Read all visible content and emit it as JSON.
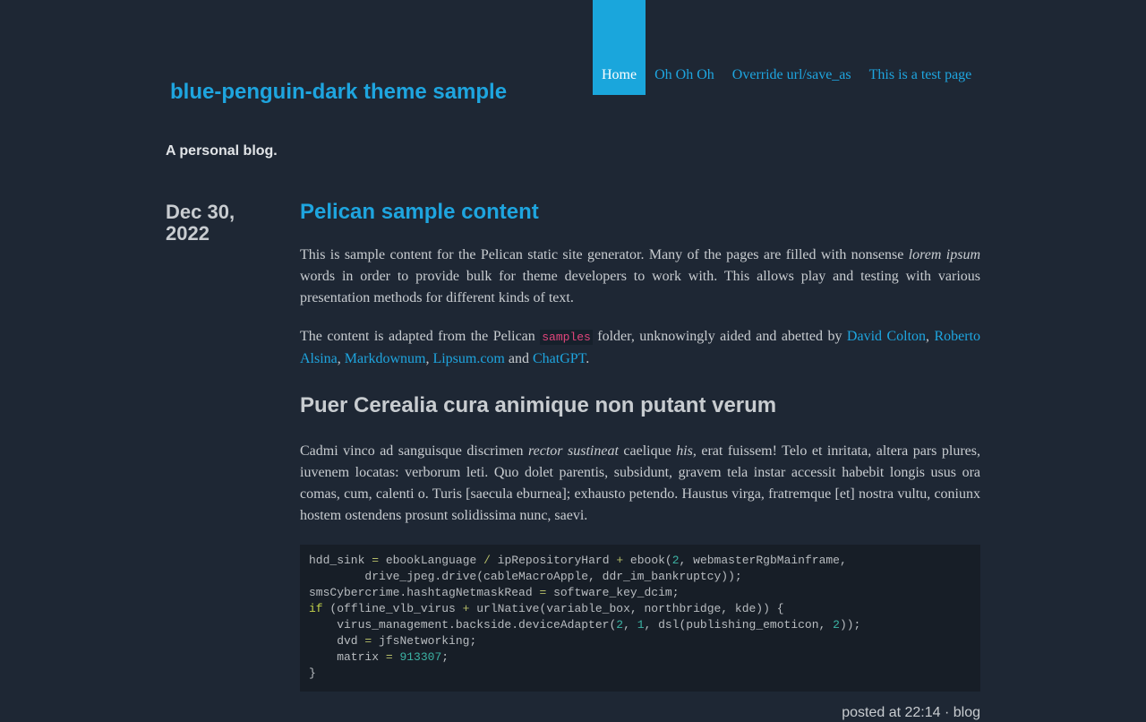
{
  "site": {
    "title": "blue-penguin-dark theme sample",
    "tagline": "A personal blog."
  },
  "nav": {
    "items": [
      {
        "label": "Home",
        "active": true
      },
      {
        "label": "Oh Oh Oh",
        "active": false
      },
      {
        "label": "Override url/save_as",
        "active": false
      },
      {
        "label": "This is a test page",
        "active": false
      }
    ]
  },
  "article": {
    "date": "Dec 30, 2022",
    "title": "Pelican sample content",
    "p1": {
      "text1": "This is sample content for the Pelican static site generator. Many of the pages are filled with nonsense ",
      "em": "lorem ipsum",
      "text2": " words in order to provide bulk for theme developers to work with. This allows play and testing with various presentation methods for different kinds of text."
    },
    "p2": {
      "text1": "The content is adapted from the Pelican ",
      "code": "samples",
      "text2": " folder, unknowingly aided and abetted by ",
      "link1": "David Colton",
      "sep1": ", ",
      "link2": "Roberto Alsina",
      "sep2": ", ",
      "link3": "Markdownum",
      "sep3": ", ",
      "link4": "Lipsum.com",
      "sep4": " and ",
      "link5": "ChatGPT",
      "end": "."
    },
    "heading2": "Puer Cerealia cura animique non putant verum",
    "p3": {
      "text1": "Cadmi vinco ad sanguisque discrimen ",
      "em1": "rector sustineat",
      "text2": " caelique ",
      "em2": "his",
      "text3": ", erat fuissem! Telo et inritata, altera pars plures, iuvenem locatas: verborum leti. Quo dolet parentis, subsidunt, gravem tela instar accessit habebit longis usus ora comas, cum, calenti o. Turis [saecula eburnea]; exhausto petendo. Haustus virga, fratremque [et] nostra vultu, coniunx hostem ostendens prosunt solidissima nunc, saevi."
    },
    "code_lines": [
      "hdd_sink = ebookLanguage / ipRepositoryHard + ebook(2, webmasterRgbMainframe,",
      "        drive_jpeg.drive(cableMacroApple, ddr_im_bankruptcy));",
      "smsCybercrime.hashtagNetmaskRead = software_key_dcim;",
      "if (offline_vlb_virus + urlNative(variable_box, northbridge, kde)) {",
      "    virus_management.backside.deviceAdapter(2, 1, dsl(publishing_emoticon, 2));",
      "    dvd = jfsNetworking;",
      "    matrix = 913307;",
      "}"
    ],
    "meta": {
      "posted": "posted at 22:14",
      "sep": " · ",
      "category": "blog"
    }
  }
}
